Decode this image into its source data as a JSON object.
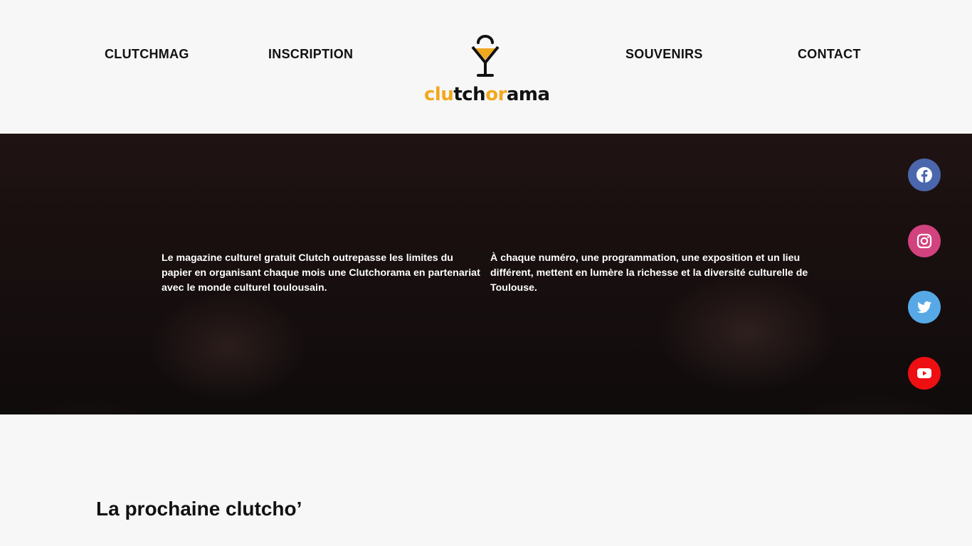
{
  "nav": {
    "items": [
      {
        "label": "CLUTCHMAG"
      },
      {
        "label": "INSCRIPTION"
      },
      {
        "label": "SOUVENIRS"
      },
      {
        "label": "CONTACT"
      }
    ]
  },
  "logo": {
    "word_parts": [
      "clu",
      "tch",
      "or",
      "ama"
    ]
  },
  "hero": {
    "text_left": "Le magazine culturel gratuit Clutch outrepasse les limites du papier en organisant chaque mois une Clutchorama en partenariat avec le monde culturel toulousain.",
    "text_right": "À chaque numéro, une programmation, une exposition et un lieu différent, mettent en lumère la richesse et la diversité culturelle de Toulouse."
  },
  "social": [
    {
      "icon": "facebook-icon",
      "color": "#4a67ad"
    },
    {
      "icon": "instagram-icon",
      "color": "#d2427e"
    },
    {
      "icon": "twitter-icon",
      "color": "#56a9e6"
    },
    {
      "icon": "youtube-icon",
      "color": "#ee0f12"
    }
  ],
  "section": {
    "title": "La prochaine clutcho’"
  },
  "colors": {
    "accent": "#f2a81d",
    "background": "#f7f7f7",
    "text": "#111111"
  }
}
